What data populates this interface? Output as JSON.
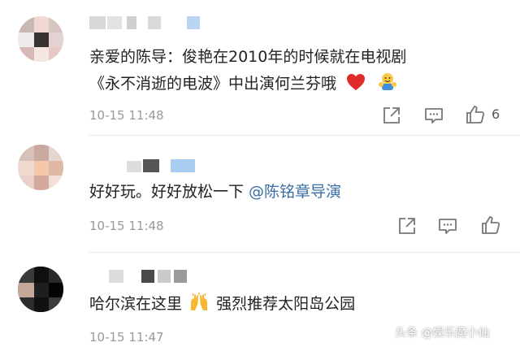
{
  "comments": [
    {
      "text_line1": "亲爱的陈导：俊艳在2010年的时候就在电视剧",
      "text_line2": "《永不消逝的电波》中出演何兰芬哦",
      "time": "10-15 11:48",
      "like_count": "6"
    },
    {
      "text": "好好玩。好好放松一下 ",
      "mention": "@陈铭章导演",
      "time": "10-15 11:48"
    },
    {
      "text_a": "哈尔滨在这里",
      "text_b": "强烈推荐太阳岛公园",
      "time": "10-15 11:47"
    }
  ],
  "watermark": "头条 @娱乐魔小仙",
  "icons": {
    "share": "share-icon",
    "comment": "comment-icon",
    "like": "thumbs-up-icon",
    "heart": "red-heart-emoji",
    "hug": "hug-emoji",
    "raised_hands": "raising-hands-emoji"
  },
  "colors": {
    "text": "#222222",
    "time": "#9a9a9a",
    "mention": "#3a6ea5",
    "heart": "#e02b2b"
  }
}
